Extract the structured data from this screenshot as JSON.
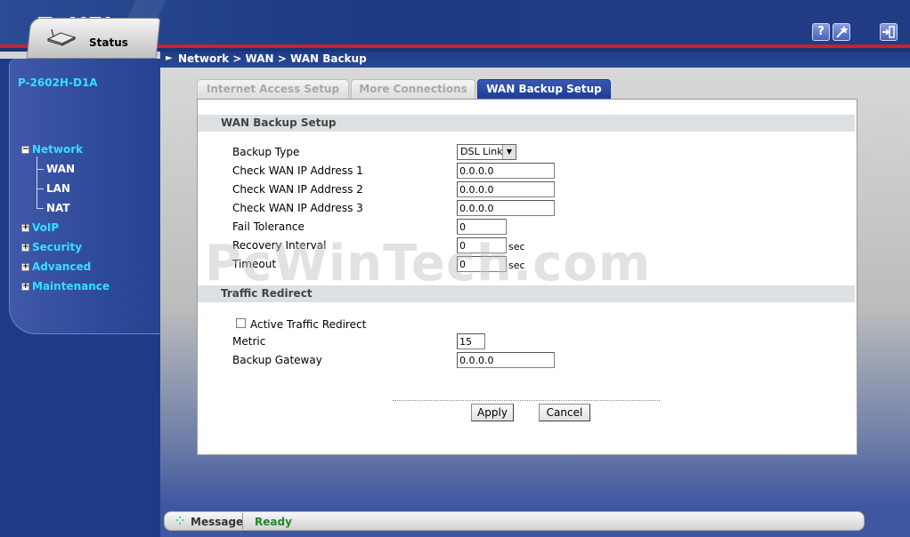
{
  "header": {
    "logo": "ZyXEL",
    "help_icon": "question-icon",
    "wizard_icon": "wizard-icon",
    "logout_icon": "logout-icon"
  },
  "sidebar": {
    "status_label": "Status",
    "device_name": "P-2602H-D1A",
    "items": [
      {
        "label": "Network",
        "expanded": true,
        "children": [
          "WAN",
          "LAN",
          "NAT"
        ]
      },
      {
        "label": "VoIP"
      },
      {
        "label": "Security"
      },
      {
        "label": "Advanced"
      },
      {
        "label": "Maintenance"
      }
    ]
  },
  "breadcrumb": "Network > WAN > WAN Backup",
  "tabs": [
    {
      "label": "Internet Access Setup",
      "active": false
    },
    {
      "label": "More Connections",
      "active": false
    },
    {
      "label": "WAN Backup Setup",
      "active": true
    }
  ],
  "wan_backup": {
    "section_title": "WAN Backup Setup",
    "backup_type_label": "Backup Type",
    "backup_type_value": "DSL Link",
    "check_ip1_label": "Check WAN IP Address  1",
    "check_ip1_value": "0.0.0.0",
    "check_ip2_label": "Check WAN IP Address  2",
    "check_ip2_value": "0.0.0.0",
    "check_ip3_label": "Check WAN IP Address  3",
    "check_ip3_value": "0.0.0.0",
    "fail_tolerance_label": "Fail Tolerance",
    "fail_tolerance_value": "0",
    "recovery_interval_label": "Recovery Interval",
    "recovery_interval_value": "0",
    "recovery_unit": "sec",
    "timeout_label": "Timeout",
    "timeout_value": "0",
    "timeout_unit": "sec"
  },
  "traffic_redirect": {
    "section_title": "Traffic Redirect",
    "active_label": "Active Traffic Redirect",
    "active_checked": false,
    "metric_label": "Metric",
    "metric_value": "15",
    "gateway_label": "Backup Gateway",
    "gateway_value": "0.0.0.0"
  },
  "buttons": {
    "apply": "Apply",
    "cancel": "Cancel"
  },
  "watermark": "PcWinTech.com",
  "message": {
    "label": "Message",
    "text": "Ready"
  },
  "colors": {
    "nav_accent": "#33e0ff",
    "header_blue": "#1d3a82",
    "header_red": "#c8242a",
    "status_green": "#1e8a2c"
  }
}
